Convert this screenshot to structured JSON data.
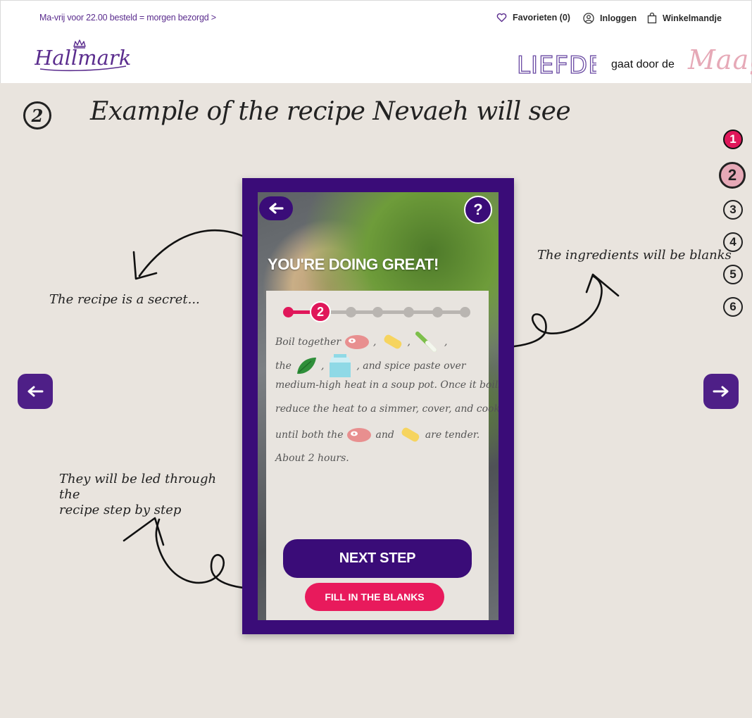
{
  "header": {
    "promo": "Ma-vrij voor 22.00 besteld = morgen bezorgd >",
    "favorites": "Favorieten (0)",
    "login": "Inloggen",
    "cart": "Winkelmandje",
    "logo_text": "Hallmark",
    "tagline": {
      "word1": "LIEFDE",
      "middle": "gaat door de",
      "word2": "Maag"
    }
  },
  "slide": {
    "step_number": "2",
    "title": "Example of the recipe Nevaeh will see"
  },
  "steps_nav": {
    "items": [
      {
        "label": "1",
        "state": "done"
      },
      {
        "label": "2",
        "state": "current"
      },
      {
        "label": "3",
        "state": "todo"
      },
      {
        "label": "4",
        "state": "todo"
      },
      {
        "label": "5",
        "state": "todo"
      },
      {
        "label": "6",
        "state": "todo"
      }
    ]
  },
  "annotations": {
    "secret": "The recipe is a secret...",
    "blanks": "The ingredients will be blanks",
    "guided_line1": "They will be led through the",
    "guided_line2": "recipe step by step"
  },
  "phone": {
    "encouragement": "YOU'RE DOING GREAT!",
    "help": "?",
    "current_step": "2",
    "progress": {
      "current": 2,
      "total": 7
    },
    "recipe": {
      "line1_text": "Boil together",
      "line2_the": "the",
      "line2_rest": ", and spice paste over",
      "line3": "medium-high heat in a soup pot. Once it boils,",
      "line4": "reduce the heat to a simmer, cover, and cook",
      "line5_a": "until both the",
      "line5_and": "and",
      "line5_end": "are tender.",
      "line6": "About 2 hours."
    },
    "next_step": "NEXT STEP",
    "fill_blanks": "FILL IN THE BLANKS"
  },
  "colors": {
    "purple": "#3a0c78",
    "nav_purple": "#4e1f87",
    "pink": "#e0175a",
    "soft_pink": "#e6a9b7",
    "background": "#e9e4de"
  },
  "icons": [
    "heart-icon",
    "user-icon",
    "bag-icon",
    "arrow-left-icon",
    "arrow-right-icon",
    "crown-icon",
    "question-icon",
    "meat-icon",
    "noodle-icon",
    "leek-icon",
    "leaf-icon",
    "milk-carton-icon"
  ]
}
